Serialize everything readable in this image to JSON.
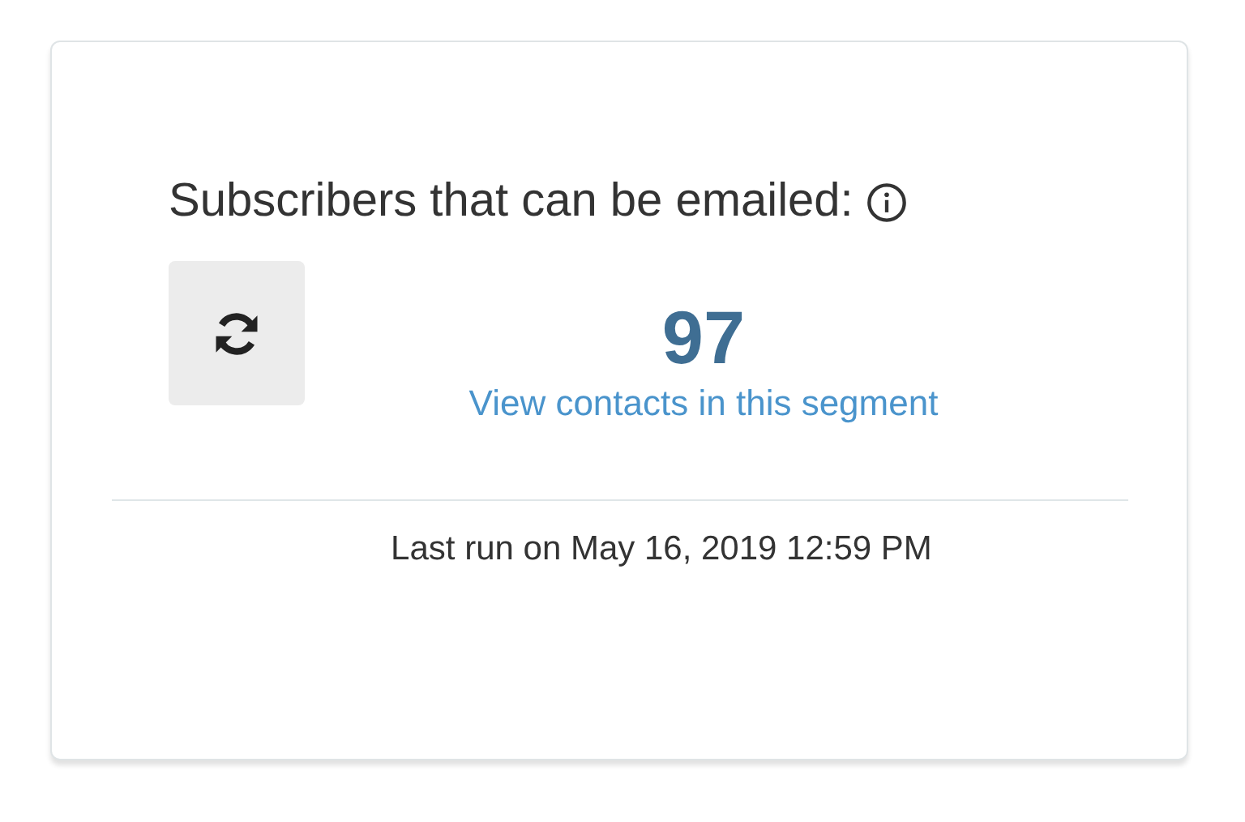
{
  "card": {
    "title": "Subscribers that can be emailed:",
    "count": "97",
    "link": "View contacts in this segment",
    "last_run": "Last run on May 16, 2019 12:59 PM"
  }
}
